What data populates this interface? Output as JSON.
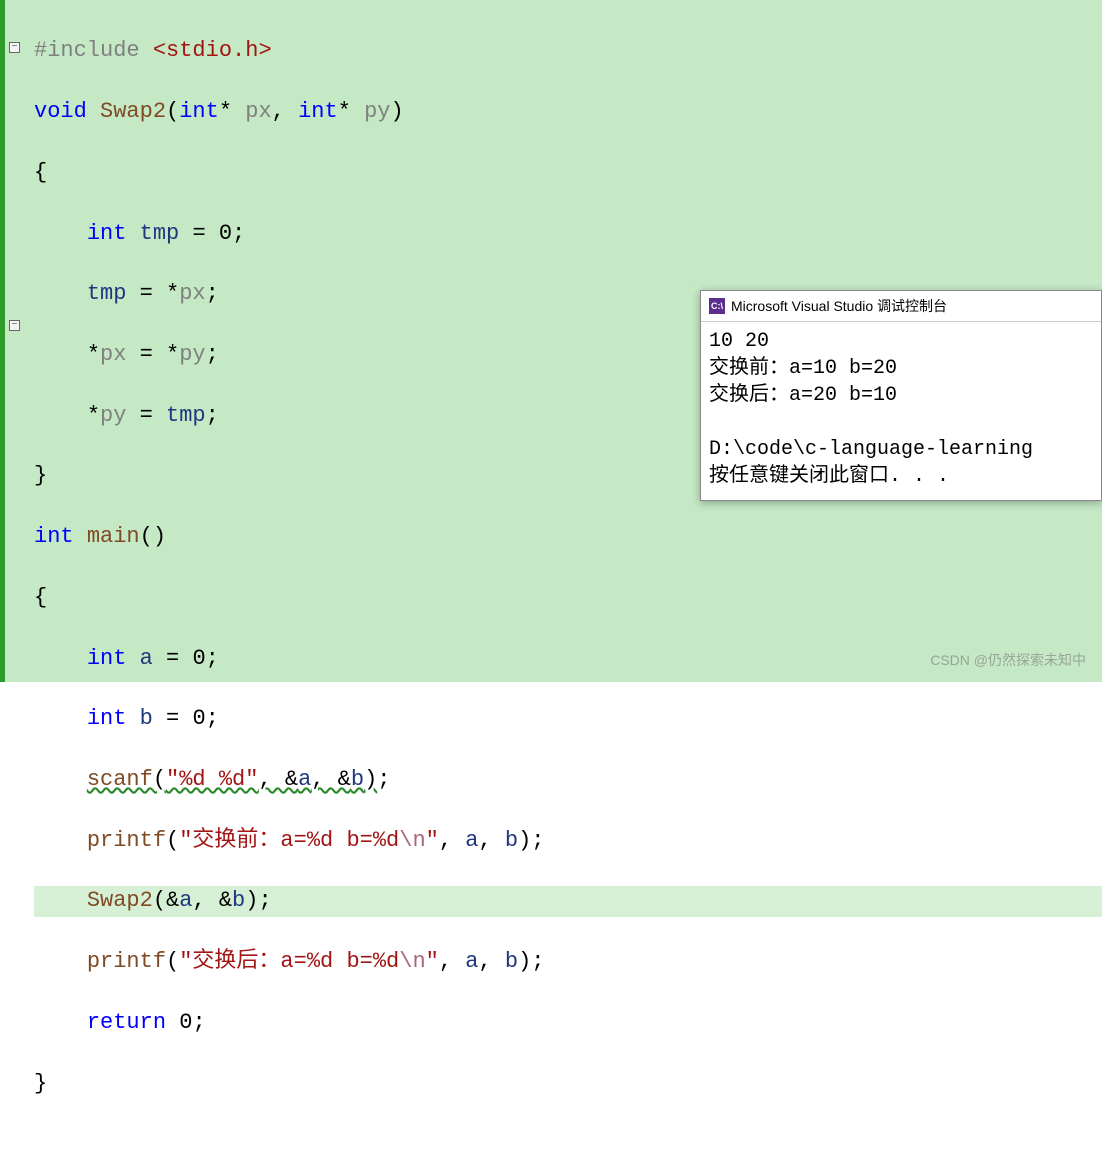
{
  "code": {
    "include_directive": "#include",
    "include_path": " <stdio.h>",
    "kw_void": "void",
    "fn_swap2": "Swap2",
    "kw_int": "int",
    "param_px": "px",
    "param_py": "py",
    "var_tmp": "tmp",
    "num_zero": "0",
    "fn_main": "main",
    "var_a": "a",
    "var_b": "b",
    "fn_scanf": "scanf",
    "str_scanf": "\"%d %d\"",
    "fn_printf": "printf",
    "str_before_p1": "\"交换前：a=%d b=%d",
    "str_after_p1": "\"交换后：a=%d b=%d",
    "esc_n": "\\n",
    "str_close": "\"",
    "kw_return": "return"
  },
  "console": {
    "title": "Microsoft Visual Studio 调试控制台",
    "icon_text": "C:\\",
    "lines": {
      "l1": "10 20",
      "l2": "交换前：a=10 b=20",
      "l3": "交换后：a=20 b=10",
      "l4": "",
      "l5": "D:\\code\\c-language-learning",
      "l6": "按任意键关闭此窗口. . ."
    }
  },
  "watermark": "CSDN @仍然探索未知中"
}
